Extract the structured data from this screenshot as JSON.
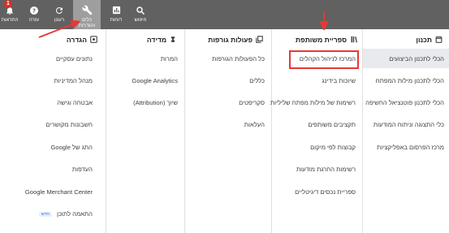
{
  "toolbar": {
    "notifications": "התראות",
    "help": "עזרה",
    "refresh": "רענון",
    "tools_line1": "כלים",
    "tools_line2": "והגדרות",
    "reports": "דוחות",
    "search": "חיפוש",
    "badge_count": "1"
  },
  "columns": {
    "planning": {
      "title": "תכנון",
      "items": [
        "הכלי לתכנון הביצועים",
        "הכלי לתכנון מילות המפתח",
        "הכלי לתכנון פוטנציאל החשיפה",
        "כלי התצוגה וניתוח המודעות",
        "מרכז הפרסום באפליקציות"
      ]
    },
    "shared_library": {
      "title": "ספריית משותפת",
      "items": [
        "המרכז לניהול הקהלים",
        "שיוכות בידינג",
        "רשימות של מילות מפתח שליליות",
        "תקציבים משותפים",
        "קבוצות לפי מיקום",
        "רשימות החרגת מודעות",
        "ספריית נכסים דיגיטליים"
      ]
    },
    "bulk_actions": {
      "title": "פעולות גורפות",
      "items": [
        "כל הפעולות הגורפות",
        "כללים",
        "סקריפטים",
        "העלאות"
      ]
    },
    "measurement": {
      "title": "מדידה",
      "items": [
        "המרות",
        "Google Analytics",
        "שיוך (Attribution)"
      ]
    },
    "setup": {
      "title": "הגדרה",
      "items": [
        "נתונים עסקיים",
        "מנהל המדיניות",
        "אבטחה וגישה",
        "חשבונות מקושרים",
        "התג של Google",
        "העדפות",
        "Google Merchant Center",
        "התאמה לתוכן"
      ],
      "new_label": "חדש"
    }
  }
}
